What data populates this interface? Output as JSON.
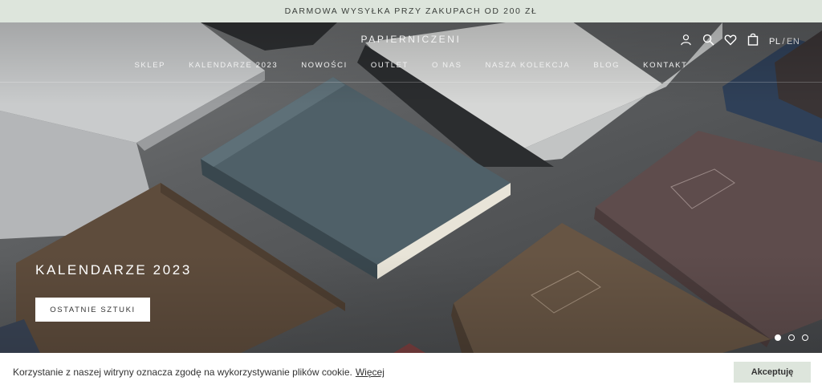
{
  "announcement": "DARMOWA WYSYŁKA PRZY ZAKUPACH OD 200 ZŁ",
  "header": {
    "brand": "PAPIERNICZENI",
    "nav": [
      "SKLEP",
      "KALENDARZE 2023",
      "NOWOŚCI",
      "OUTLET",
      "O NAS",
      "NASZA KOLEKCJA",
      "BLOG",
      "KONTAKT"
    ],
    "icons": [
      "account-icon",
      "search-icon",
      "heart-icon",
      "bag-icon"
    ],
    "lang": {
      "active": "PL",
      "separator": "/",
      "other": "EN"
    }
  },
  "hero": {
    "title": "KALENDARZE 2023",
    "button": "OSTATNIE SZTUKI",
    "slides": 3,
    "active_slide": 1
  },
  "cookie": {
    "message": "Korzystanie z naszej witryny oznacza zgodę na wykorzystywanie plików cookie.",
    "link": "Więcej",
    "accept": "Akceptuję"
  },
  "colors": {
    "accent": "#dde5dc",
    "text": "#333333"
  }
}
